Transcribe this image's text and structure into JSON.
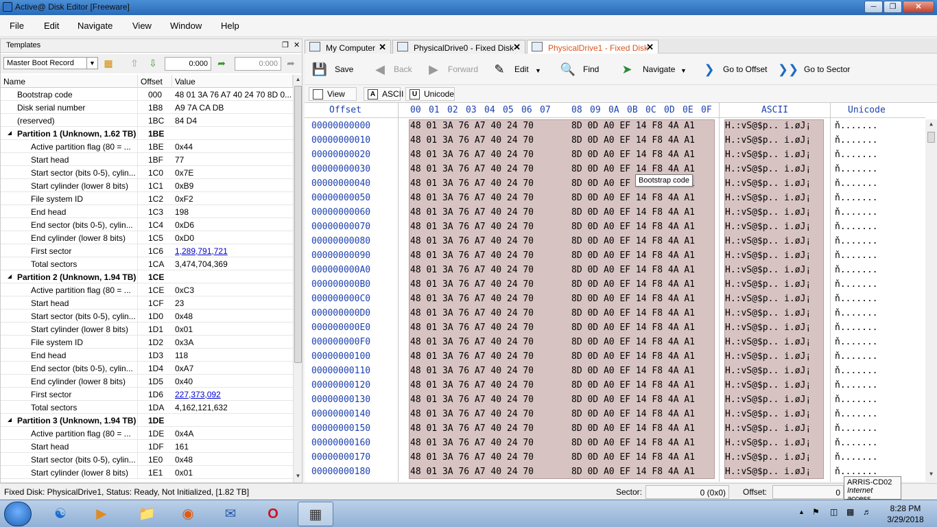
{
  "window": {
    "title": "Active@ Disk Editor [Freeware]"
  },
  "menu": [
    "File",
    "Edit",
    "Navigate",
    "View",
    "Window",
    "Help"
  ],
  "templates": {
    "title": "Templates",
    "selected": "Master Boot Record",
    "offset_value": "0:000",
    "offset_value2": "0:000",
    "columns": [
      "Name",
      "Offset",
      "Value"
    ],
    "rows": [
      {
        "name": "Bootstrap code",
        "offset": "000",
        "value": "48 01 3A 76 A7 40 24 70 8D 0...",
        "level": 1
      },
      {
        "name": "Disk serial number",
        "offset": "1B8",
        "value": "A9 7A CA DB",
        "level": 1
      },
      {
        "name": "(reserved)",
        "offset": "1BC",
        "value": "84 D4",
        "level": 1
      },
      {
        "name": "Partition 1 (Unknown, 1.62 TB)",
        "offset": "1BE",
        "value": "",
        "level": 0
      },
      {
        "name": "Active partition flag (80 = ...",
        "offset": "1BE",
        "value": "0x44",
        "level": 2
      },
      {
        "name": "Start head",
        "offset": "1BF",
        "value": "77",
        "level": 2
      },
      {
        "name": "Start sector (bits 0-5), cylin...",
        "offset": "1C0",
        "value": "0x7E",
        "level": 2
      },
      {
        "name": "Start cylinder (lower 8 bits)",
        "offset": "1C1",
        "value": "0xB9",
        "level": 2
      },
      {
        "name": "File system ID",
        "offset": "1C2",
        "value": "0xF2",
        "level": 2
      },
      {
        "name": "End head",
        "offset": "1C3",
        "value": "198",
        "level": 2
      },
      {
        "name": "End sector (bits 0-5), cylin...",
        "offset": "1C4",
        "value": "0xD6",
        "level": 2
      },
      {
        "name": "End cylinder (lower 8 bits)",
        "offset": "1C5",
        "value": "0xD0",
        "level": 2
      },
      {
        "name": "First sector",
        "offset": "1C6",
        "value": "1,289,791,721",
        "level": 2,
        "link": true
      },
      {
        "name": "Total sectors",
        "offset": "1CA",
        "value": "3,474,704,369",
        "level": 2
      },
      {
        "name": "Partition 2 (Unknown, 1.94 TB)",
        "offset": "1CE",
        "value": "",
        "level": 0
      },
      {
        "name": "Active partition flag (80 = ...",
        "offset": "1CE",
        "value": "0xC3",
        "level": 2
      },
      {
        "name": "Start head",
        "offset": "1CF",
        "value": "23",
        "level": 2
      },
      {
        "name": "Start sector (bits 0-5), cylin...",
        "offset": "1D0",
        "value": "0x48",
        "level": 2
      },
      {
        "name": "Start cylinder (lower 8 bits)",
        "offset": "1D1",
        "value": "0x01",
        "level": 2
      },
      {
        "name": "File system ID",
        "offset": "1D2",
        "value": "0x3A",
        "level": 2
      },
      {
        "name": "End head",
        "offset": "1D3",
        "value": "118",
        "level": 2
      },
      {
        "name": "End sector (bits 0-5), cylin...",
        "offset": "1D4",
        "value": "0xA7",
        "level": 2
      },
      {
        "name": "End cylinder (lower 8 bits)",
        "offset": "1D5",
        "value": "0x40",
        "level": 2
      },
      {
        "name": "First sector",
        "offset": "1D6",
        "value": "227,373,092",
        "level": 2,
        "link": true
      },
      {
        "name": "Total sectors",
        "offset": "1DA",
        "value": "4,162,121,632",
        "level": 2
      },
      {
        "name": "Partition 3 (Unknown, 1.94 TB)",
        "offset": "1DE",
        "value": "",
        "level": 0
      },
      {
        "name": "Active partition flag (80 = ...",
        "offset": "1DE",
        "value": "0x4A",
        "level": 2
      },
      {
        "name": "Start head",
        "offset": "1DF",
        "value": "161",
        "level": 2
      },
      {
        "name": "Start sector (bits 0-5), cylin...",
        "offset": "1E0",
        "value": "0x48",
        "level": 2
      },
      {
        "name": "Start cylinder (lower 8 bits)",
        "offset": "1E1",
        "value": "0x01",
        "level": 2
      }
    ]
  },
  "tabs": [
    {
      "label": "My Computer",
      "active": false
    },
    {
      "label": "PhysicalDrive0 - Fixed Disk",
      "active": false
    },
    {
      "label": "PhysicalDrive1 - Fixed Disk",
      "active": true
    }
  ],
  "toolbar": {
    "save": "Save",
    "back": "Back",
    "forward": "Forward",
    "edit": "Edit",
    "find": "Find",
    "navigate": "Navigate",
    "goto_offset": "Go to Offset",
    "goto_sector": "Go to Sector"
  },
  "viewbar": {
    "view": "View",
    "ascii": "ASCII",
    "unicode": "Unicode",
    "ascii_icon": "A",
    "unicode_icon": "U"
  },
  "hex": {
    "offset_header": "Offset",
    "column_headers": [
      "00",
      "01",
      "02",
      "03",
      "04",
      "05",
      "06",
      "07",
      "08",
      "09",
      "0A",
      "0B",
      "0C",
      "0D",
      "0E",
      "0F"
    ],
    "ascii_header": "ASCII",
    "unicode_header": "Unicode",
    "row_bytes_1": "48 01 3A 76 A7 40 24 70",
    "row_bytes_2": "8D 0D A0 EF 14 F8 4A A1",
    "row_ascii": "H.:vS@$p.. i.øJ¡",
    "row_unicode": "ň.......",
    "offsets": [
      "00000000000",
      "00000000010",
      "00000000020",
      "00000000030",
      "00000000040",
      "00000000050",
      "00000000060",
      "00000000070",
      "00000000080",
      "00000000090",
      "000000000A0",
      "000000000B0",
      "000000000C0",
      "000000000D0",
      "000000000E0",
      "000000000F0",
      "00000000100",
      "00000000110",
      "00000000120",
      "00000000130",
      "00000000140",
      "00000000150",
      "00000000160",
      "00000000170",
      "00000000180"
    ],
    "tooltip": "Bootstrap code"
  },
  "status": {
    "text": "Fixed Disk: PhysicalDrive1, Status: Ready, Not Initialized, [1.82 TB]",
    "sector_label": "Sector:",
    "sector_value": "0 (0x0)",
    "offset_label": "Offset:",
    "offset_value": "0"
  },
  "network_tip": {
    "name": "ARRIS-CD02",
    "status": "Internet access"
  },
  "taskbar": {
    "time": "8:28 PM",
    "date": "3/29/2018"
  }
}
